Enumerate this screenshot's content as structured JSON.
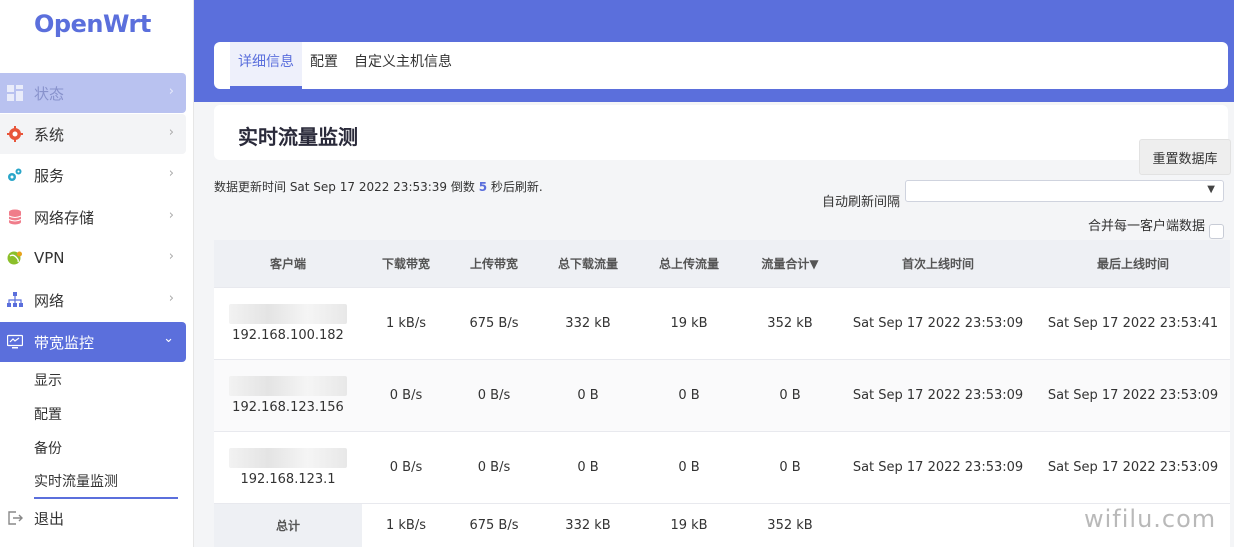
{
  "app": {
    "logo": "OpenWrt"
  },
  "sidebar": {
    "items": [
      {
        "label": "状态",
        "icon": "dashboard-icon"
      },
      {
        "label": "系统",
        "icon": "gear-icon"
      },
      {
        "label": "服务",
        "icon": "services-icon"
      },
      {
        "label": "网络存储",
        "icon": "storage-icon"
      },
      {
        "label": "VPN",
        "icon": "vpn-icon"
      },
      {
        "label": "网络",
        "icon": "network-icon"
      },
      {
        "label": "带宽监控",
        "icon": "monitor-icon"
      }
    ],
    "sub_items": [
      "显示",
      "配置",
      "备份",
      "实时流量监测"
    ],
    "logout": "退出"
  },
  "tabs": [
    "详细信息",
    "配置",
    "自定义主机信息"
  ],
  "page": {
    "title": "实时流量监测",
    "reset_button": "重置数据库",
    "update_prefix": "数据更新时间 Sat Sep 17 2022 23:53:39 倒数",
    "countdown": "5",
    "update_suffix": "秒后刷新.",
    "interval_label": "自动刷新间隔",
    "interval_value": "",
    "merge_label": "合并每一客户端数据"
  },
  "table": {
    "headers": [
      "客户端",
      "下载带宽",
      "上传带宽",
      "总下载流量",
      "总上传流量",
      "流量合计▼",
      "首次上线时间",
      "最后上线时间"
    ],
    "rows": [
      [
        "192.168.100.182",
        "1 kB/s",
        "675 B/s",
        "332 kB",
        "19 kB",
        "352 kB",
        "Sat Sep 17 2022 23:53:09",
        "Sat Sep 17 2022 23:53:41"
      ],
      [
        "192.168.123.156",
        "0 B/s",
        "0 B/s",
        "0 B",
        "0 B",
        "0 B",
        "Sat Sep 17 2022 23:53:09",
        "Sat Sep 17 2022 23:53:09"
      ],
      [
        "192.168.123.1",
        "0 B/s",
        "0 B/s",
        "0 B",
        "0 B",
        "0 B",
        "Sat Sep 17 2022 23:53:09",
        "Sat Sep 17 2022 23:53:09"
      ]
    ],
    "footer": [
      "总计",
      "1 kB/s",
      "675 B/s",
      "332 kB",
      "19 kB",
      "352 kB"
    ]
  },
  "watermark": "wifilu.com",
  "colors": {
    "accent": "#5b6fdc",
    "accent_light": "#b9c2f0"
  }
}
